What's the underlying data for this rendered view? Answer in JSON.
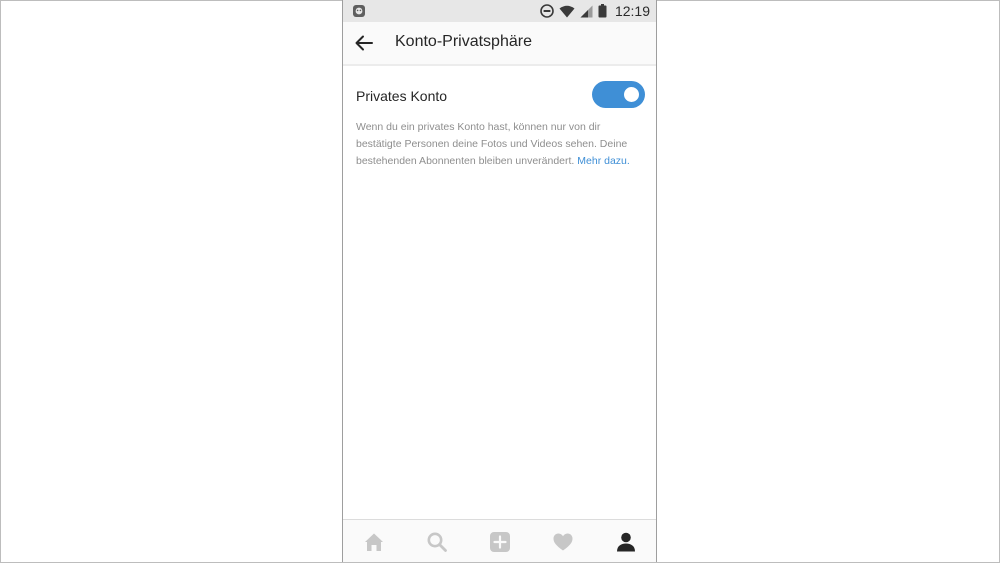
{
  "status_bar": {
    "time": "12:19"
  },
  "header": {
    "title": "Konto-Privatsphäre"
  },
  "settings": {
    "private_account_label": "Privates Konto",
    "private_account_enabled": true,
    "description_text": "Wenn du ein privates Konto hast, können nur von dir bestätigte Personen deine Fotos und Videos sehen. Deine bestehenden Abonnenten bleiben unverändert.",
    "learn_more_link": "Mehr dazu."
  },
  "bottom_nav": {
    "items": [
      "home-icon",
      "search-icon",
      "add-post-icon",
      "activity-heart-icon",
      "profile-icon"
    ],
    "active": "profile-icon"
  },
  "colors": {
    "accent": "#3f8fd6",
    "text_primary": "#262626",
    "text_secondary": "#8e8e8e",
    "icon_inactive": "#c7c7c7",
    "icon_active": "#262626"
  }
}
